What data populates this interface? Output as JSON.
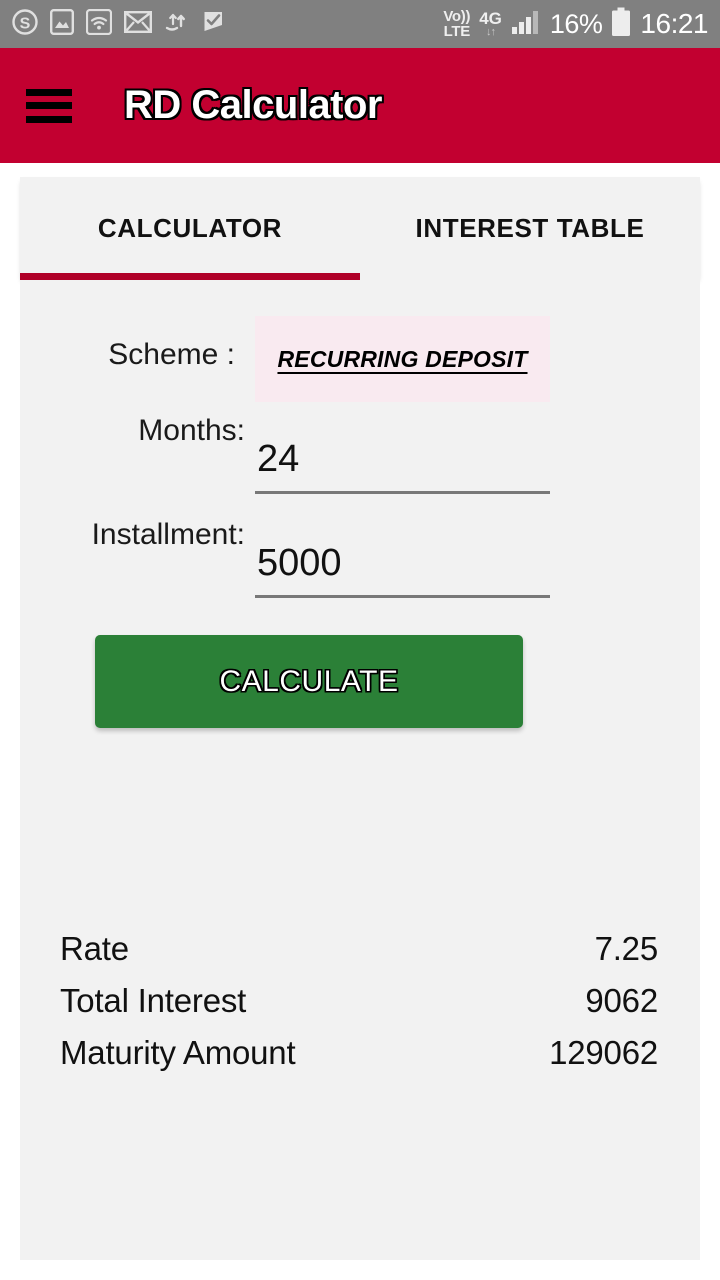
{
  "status_bar": {
    "background": "#808080",
    "left_icons": [
      {
        "name": "skype-icon",
        "glyph": "S"
      },
      {
        "name": "image-icon",
        "glyph": "picture"
      },
      {
        "name": "wifi-icon",
        "glyph": "wifi"
      },
      {
        "name": "mail-icon",
        "glyph": "envelope"
      },
      {
        "name": "data-transfer-icon",
        "glyph": "updown"
      },
      {
        "name": "checkmark-flag-icon",
        "glyph": "flagcheck"
      }
    ],
    "volte_top": "Vo))",
    "volte_bottom": "LTE",
    "network_type": "4G",
    "network_arrows": "↓↑",
    "signal_icon": "signal-bars-icon",
    "battery_percent": "16%",
    "battery_icon": "battery-icon",
    "time": "16:21"
  },
  "app_bar": {
    "background": "#c20030",
    "menu_icon": "hamburger-menu-icon",
    "title": "RD Calculator"
  },
  "tabs": {
    "active_index": 0,
    "indicator_color": "#b00028",
    "items": [
      {
        "label": "CALCULATOR"
      },
      {
        "label": "INTEREST TABLE"
      }
    ]
  },
  "form": {
    "scheme": {
      "label": "Scheme :",
      "value": "RECURRING DEPOSIT",
      "box_color": "#f9eaf0"
    },
    "months": {
      "label": "Months:",
      "value": "24",
      "placeholder": ""
    },
    "installment": {
      "label": "Installment:",
      "value": "5000",
      "placeholder": ""
    },
    "calculate_button": {
      "label": "CALCULATE",
      "color": "#2b8037"
    }
  },
  "results": {
    "rows": [
      {
        "label": "Rate",
        "value": "7.25"
      },
      {
        "label": "Total Interest",
        "value": "9062"
      },
      {
        "label": "Maturity Amount",
        "value": "129062"
      }
    ]
  }
}
